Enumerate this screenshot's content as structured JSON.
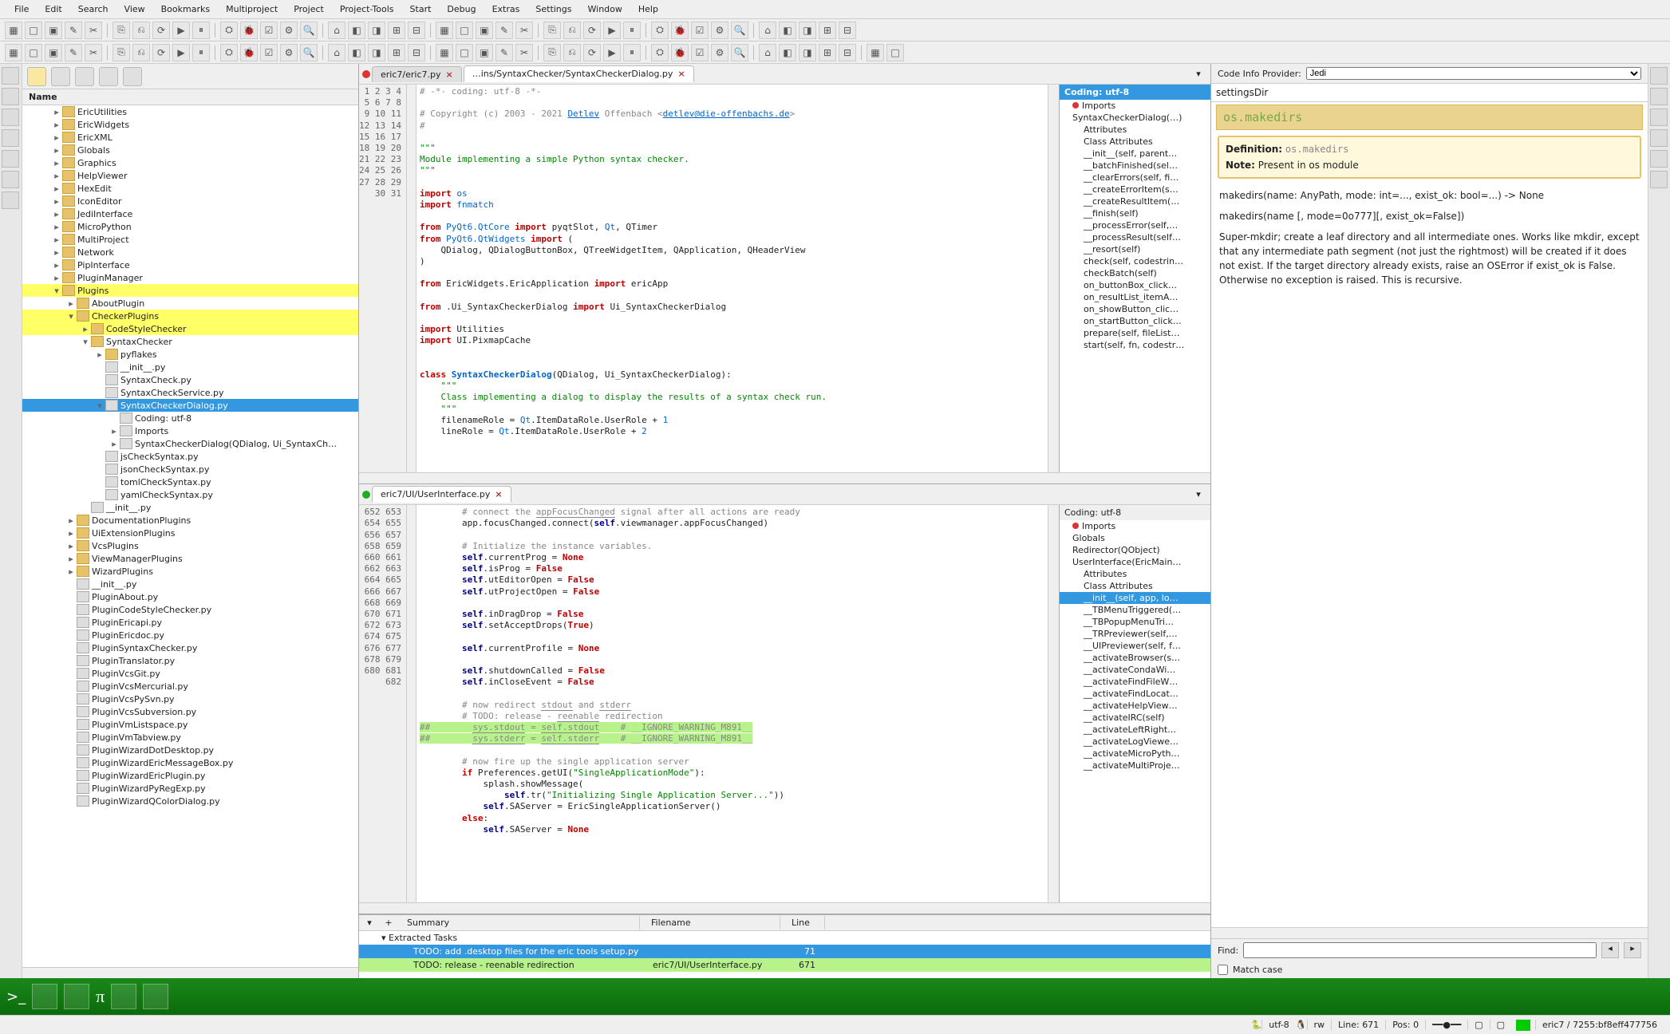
{
  "menu": [
    "File",
    "Edit",
    "Search",
    "View",
    "Bookmarks",
    "Multiproject",
    "Project",
    "Project-Tools",
    "Start",
    "Debug",
    "Extras",
    "Settings",
    "Window",
    "Help"
  ],
  "sidebar": {
    "header": "Name",
    "rows": [
      {
        "ind": 36,
        "exp": "▸",
        "icon": "folder",
        "label": "EricUtilities"
      },
      {
        "ind": 36,
        "exp": "▸",
        "icon": "folder",
        "label": "EricWidgets"
      },
      {
        "ind": 36,
        "exp": "▸",
        "icon": "folder",
        "label": "EricXML"
      },
      {
        "ind": 36,
        "exp": "▸",
        "icon": "folder",
        "label": "Globals"
      },
      {
        "ind": 36,
        "exp": "▸",
        "icon": "folder",
        "label": "Graphics"
      },
      {
        "ind": 36,
        "exp": "▸",
        "icon": "folder",
        "label": "HelpViewer"
      },
      {
        "ind": 36,
        "exp": "▸",
        "icon": "folder",
        "label": "HexEdit"
      },
      {
        "ind": 36,
        "exp": "▸",
        "icon": "folder",
        "label": "IconEditor"
      },
      {
        "ind": 36,
        "exp": "▸",
        "icon": "folder",
        "label": "JediInterface"
      },
      {
        "ind": 36,
        "exp": "▸",
        "icon": "folder",
        "label": "MicroPython"
      },
      {
        "ind": 36,
        "exp": "▸",
        "icon": "folder",
        "label": "MultiProject"
      },
      {
        "ind": 36,
        "exp": "▸",
        "icon": "folder",
        "label": "Network"
      },
      {
        "ind": 36,
        "exp": "▸",
        "icon": "folder",
        "label": "PipInterface"
      },
      {
        "ind": 36,
        "exp": "▸",
        "icon": "folder",
        "label": "PluginManager"
      },
      {
        "ind": 36,
        "exp": "▾",
        "icon": "folder",
        "label": "Plugins",
        "cls": "hl-yellow"
      },
      {
        "ind": 54,
        "exp": "▸",
        "icon": "folder",
        "label": "AboutPlugin"
      },
      {
        "ind": 54,
        "exp": "▾",
        "icon": "folder",
        "label": "CheckerPlugins",
        "cls": "hl-yellow"
      },
      {
        "ind": 72,
        "exp": "▸",
        "icon": "folder",
        "label": "CodeStyleChecker",
        "cls": "hl-yellow"
      },
      {
        "ind": 72,
        "exp": "▾",
        "icon": "folder",
        "label": "SyntaxChecker"
      },
      {
        "ind": 90,
        "exp": "▸",
        "icon": "folder",
        "label": "pyflakes"
      },
      {
        "ind": 90,
        "exp": "",
        "icon": "file",
        "label": "__init__.py"
      },
      {
        "ind": 90,
        "exp": "",
        "icon": "file",
        "label": "SyntaxCheck.py"
      },
      {
        "ind": 90,
        "exp": "",
        "icon": "file",
        "label": "SyntaxCheckService.py"
      },
      {
        "ind": 90,
        "exp": "▾",
        "icon": "file",
        "label": "SyntaxCheckerDialog.py",
        "cls": "hl-blue"
      },
      {
        "ind": 108,
        "exp": "",
        "icon": "file",
        "label": "Coding: utf-8"
      },
      {
        "ind": 108,
        "exp": "▸",
        "icon": "file",
        "label": "Imports"
      },
      {
        "ind": 108,
        "exp": "▸",
        "icon": "file",
        "label": "SyntaxCheckerDialog(QDialog, Ui_SyntaxCh…"
      },
      {
        "ind": 90,
        "exp": "",
        "icon": "file",
        "label": "jsCheckSyntax.py"
      },
      {
        "ind": 90,
        "exp": "",
        "icon": "file",
        "label": "jsonCheckSyntax.py"
      },
      {
        "ind": 90,
        "exp": "",
        "icon": "file",
        "label": "tomlCheckSyntax.py"
      },
      {
        "ind": 90,
        "exp": "",
        "icon": "file",
        "label": "yamlCheckSyntax.py"
      },
      {
        "ind": 72,
        "exp": "",
        "icon": "file",
        "label": "__init__.py"
      },
      {
        "ind": 54,
        "exp": "▸",
        "icon": "folder",
        "label": "DocumentationPlugins"
      },
      {
        "ind": 54,
        "exp": "▸",
        "icon": "folder",
        "label": "UiExtensionPlugins"
      },
      {
        "ind": 54,
        "exp": "▸",
        "icon": "folder",
        "label": "VcsPlugins"
      },
      {
        "ind": 54,
        "exp": "▸",
        "icon": "folder",
        "label": "ViewManagerPlugins"
      },
      {
        "ind": 54,
        "exp": "▸",
        "icon": "folder",
        "label": "WizardPlugins"
      },
      {
        "ind": 54,
        "exp": "",
        "icon": "file",
        "label": "__init__.py"
      },
      {
        "ind": 54,
        "exp": "",
        "icon": "file",
        "label": "PluginAbout.py"
      },
      {
        "ind": 54,
        "exp": "",
        "icon": "file",
        "label": "PluginCodeStyleChecker.py"
      },
      {
        "ind": 54,
        "exp": "",
        "icon": "file",
        "label": "PluginEricapi.py"
      },
      {
        "ind": 54,
        "exp": "",
        "icon": "file",
        "label": "PluginEricdoc.py"
      },
      {
        "ind": 54,
        "exp": "",
        "icon": "file",
        "label": "PluginSyntaxChecker.py"
      },
      {
        "ind": 54,
        "exp": "",
        "icon": "file",
        "label": "PluginTranslator.py"
      },
      {
        "ind": 54,
        "exp": "",
        "icon": "file",
        "label": "PluginVcsGit.py"
      },
      {
        "ind": 54,
        "exp": "",
        "icon": "file",
        "label": "PluginVcsMercurial.py"
      },
      {
        "ind": 54,
        "exp": "",
        "icon": "file",
        "label": "PluginVcsPySvn.py"
      },
      {
        "ind": 54,
        "exp": "",
        "icon": "file",
        "label": "PluginVcsSubversion.py"
      },
      {
        "ind": 54,
        "exp": "",
        "icon": "file",
        "label": "PluginVmListspace.py"
      },
      {
        "ind": 54,
        "exp": "",
        "icon": "file",
        "label": "PluginVmTabview.py"
      },
      {
        "ind": 54,
        "exp": "",
        "icon": "file",
        "label": "PluginWizardDotDesktop.py"
      },
      {
        "ind": 54,
        "exp": "",
        "icon": "file",
        "label": "PluginWizardEricMessageBox.py"
      },
      {
        "ind": 54,
        "exp": "",
        "icon": "file",
        "label": "PluginWizardEricPlugin.py"
      },
      {
        "ind": 54,
        "exp": "",
        "icon": "file",
        "label": "PluginWizardPyRegExp.py"
      },
      {
        "ind": 54,
        "exp": "",
        "icon": "file",
        "label": "PluginWizardQColorDialog.py"
      }
    ]
  },
  "editor1": {
    "tabs": [
      {
        "dot": "red",
        "label": "eric7/eric7.py",
        "active": false
      },
      {
        "dot": "",
        "label": "…ins/SyntaxChecker/SyntaxCheckerDialog.py",
        "active": true
      }
    ],
    "lines_start": 1,
    "lines_end": 31
  },
  "editor2": {
    "tabs": [
      {
        "dot": "green",
        "label": "eric7/UI/UserInterface.py",
        "active": true
      }
    ],
    "lines_start": 652,
    "lines_end": 682
  },
  "outline1": {
    "encoding": "Coding: utf-8",
    "items": [
      {
        "label": "Imports",
        "dot": "red"
      },
      {
        "label": "SyntaxCheckerDialog(…)"
      },
      {
        "label": "Attributes",
        "ind": 1
      },
      {
        "label": "Class Attributes",
        "ind": 1
      },
      {
        "label": "__init__(self, parent…",
        "ind": 1
      },
      {
        "label": "__batchFinished(sel…",
        "ind": 1
      },
      {
        "label": "__clearErrors(self, fi…",
        "ind": 1
      },
      {
        "label": "__createErrorItem(s…",
        "ind": 1
      },
      {
        "label": "__createResultItem(…",
        "ind": 1
      },
      {
        "label": "__finish(self)",
        "ind": 1
      },
      {
        "label": "__processError(self,…",
        "ind": 1
      },
      {
        "label": "__processResult(self…",
        "ind": 1
      },
      {
        "label": "__resort(self)",
        "ind": 1
      },
      {
        "label": "check(self, codestrin…",
        "ind": 1
      },
      {
        "label": "checkBatch(self)",
        "ind": 1
      },
      {
        "label": "on_buttonBox_click…",
        "ind": 1
      },
      {
        "label": "on_resultList_itemA…",
        "ind": 1
      },
      {
        "label": "on_showButton_clic…",
        "ind": 1
      },
      {
        "label": "on_startButton_click…",
        "ind": 1
      },
      {
        "label": "prepare(self, fileList…",
        "ind": 1
      },
      {
        "label": "start(self, fn, codestr…",
        "ind": 1
      }
    ]
  },
  "outline2": {
    "encoding": "Coding: utf-8",
    "items": [
      {
        "label": "Imports",
        "dot": "red"
      },
      {
        "label": "Globals"
      },
      {
        "label": "Redirector(QObject)"
      },
      {
        "label": "UserInterface(EricMain…"
      },
      {
        "label": "Attributes",
        "ind": 1
      },
      {
        "label": "Class Attributes",
        "ind": 1
      },
      {
        "label": "__init__(self, app, lo…",
        "ind": 1,
        "selected": true
      },
      {
        "label": "__TBMenuTriggered(…",
        "ind": 1
      },
      {
        "label": "__TBPopupMenuTri…",
        "ind": 1
      },
      {
        "label": "__TRPreviewer(self,…",
        "ind": 1
      },
      {
        "label": "__UIPreviewer(self, f…",
        "ind": 1
      },
      {
        "label": "__activateBrowser(s…",
        "ind": 1
      },
      {
        "label": "__activateCondaWi…",
        "ind": 1
      },
      {
        "label": "__activateFindFileW…",
        "ind": 1
      },
      {
        "label": "__activateFindLocat…",
        "ind": 1
      },
      {
        "label": "__activateHelpView…",
        "ind": 1
      },
      {
        "label": "__activateIRC(self)",
        "ind": 1
      },
      {
        "label": "__activateLeftRight…",
        "ind": 1
      },
      {
        "label": "__activateLogViewe…",
        "ind": 1
      },
      {
        "label": "__activateMicroPyth…",
        "ind": 1
      },
      {
        "label": "__activateMultiProje…",
        "ind": 1
      }
    ]
  },
  "tasks": {
    "cols": [
      "Summary",
      "Filename",
      "Line"
    ],
    "section": "Extracted Tasks",
    "rows": [
      {
        "sel": true,
        "summary": "TODO: add .desktop files for the eric tools  setup.py",
        "file": "",
        "line": "71"
      },
      {
        "hl": true,
        "summary": "TODO: release - reenable redirection",
        "file": "eric7/UI/UserInterface.py",
        "line": "671"
      }
    ]
  },
  "info": {
    "provider_label": "Code Info Provider:",
    "provider": "Jedi",
    "entry": "settingsDir",
    "title": "os.makedirs",
    "def_label": "Definition:",
    "def_value": "os.makedirs",
    "note_label": "Note:",
    "note_value": "Present in os module",
    "sig1": "makedirs(name: AnyPath, mode: int=..., exist_ok: bool=...) -> None",
    "sig2": "makedirs(name [, mode=0o777][, exist_ok=False])",
    "body": "Super-mkdir; create a leaf directory and all intermediate ones. Works like mkdir, except that any intermediate path segment (not just the rightmost) will be created if it does not exist. If the target directory already exists, raise an OSError if exist_ok is False. Otherwise no exception is raised. This is recursive.",
    "find_label": "Find:",
    "matchcase": "Match case"
  },
  "status": {
    "enc": "utf-8",
    "rw": "rw",
    "line_lbl": "Line:",
    "line": "671",
    "pos_lbl": "Pos:",
    "pos": "0",
    "path": "eric7 / 7255:bf8eff477756"
  }
}
